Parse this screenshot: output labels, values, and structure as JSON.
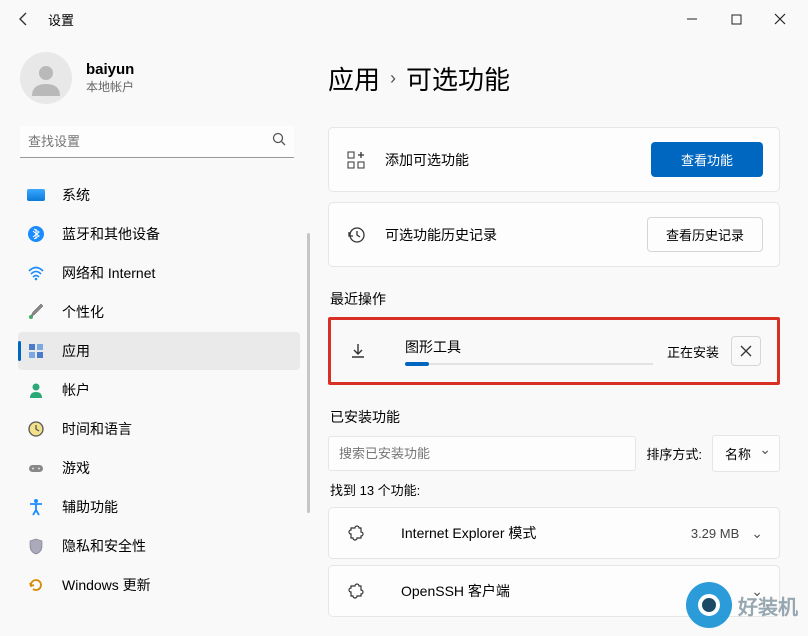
{
  "window": {
    "title": "设置",
    "min": "—",
    "max": "▢",
    "close": "✕"
  },
  "user": {
    "name": "baiyun",
    "subtitle": "本地帐户"
  },
  "search": {
    "placeholder": "查找设置"
  },
  "nav": [
    {
      "label": "系统",
      "icon": "system-icon"
    },
    {
      "label": "蓝牙和其他设备",
      "icon": "bluetooth-icon"
    },
    {
      "label": "网络和 Internet",
      "icon": "wifi-icon"
    },
    {
      "label": "个性化",
      "icon": "brush-icon"
    },
    {
      "label": "应用",
      "icon": "apps-icon",
      "active": true
    },
    {
      "label": "帐户",
      "icon": "person-icon"
    },
    {
      "label": "时间和语言",
      "icon": "clock-icon"
    },
    {
      "label": "游戏",
      "icon": "gamepad-icon"
    },
    {
      "label": "辅助功能",
      "icon": "accessibility-icon"
    },
    {
      "label": "隐私和安全性",
      "icon": "shield-icon"
    },
    {
      "label": "Windows 更新",
      "icon": "update-icon"
    }
  ],
  "breadcrumb": {
    "parent": "应用",
    "sep": "›",
    "current": "可选功能"
  },
  "add_card": {
    "label": "添加可选功能",
    "button": "查看功能"
  },
  "history_card": {
    "label": "可选功能历史记录",
    "button": "查看历史记录"
  },
  "recent": {
    "title": "最近操作",
    "item_name": "图形工具",
    "status": "正在安装"
  },
  "installed": {
    "title": "已安装功能",
    "filter_placeholder": "搜索已安装功能",
    "sort_label": "排序方式:",
    "sort_value": "名称",
    "count": "找到 13 个功能:",
    "rows": [
      {
        "name": "Internet Explorer 模式",
        "size": "3.29 MB"
      },
      {
        "name": "OpenSSH 客户端",
        "size": ""
      }
    ]
  },
  "watermark": "好装机"
}
